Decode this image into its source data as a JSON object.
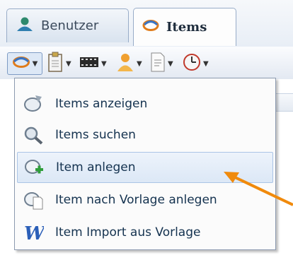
{
  "tabs": [
    {
      "label": "Benutzer",
      "icon": "user-icon",
      "active": false
    },
    {
      "label": "Items",
      "icon": "items-icon",
      "active": true
    }
  ],
  "toolbar": {
    "buttons": [
      {
        "icon": "items-icon",
        "active": true
      },
      {
        "icon": "clipboard-icon"
      },
      {
        "icon": "film-icon"
      },
      {
        "icon": "user-icon"
      },
      {
        "icon": "document-icon"
      },
      {
        "icon": "clock-icon"
      }
    ]
  },
  "menu": {
    "items": [
      {
        "label": "Items anzeigen",
        "icon": "items-view-icon"
      },
      {
        "label": "Items suchen",
        "icon": "search-icon"
      },
      {
        "label": "Item anlegen",
        "icon": "add-item-icon",
        "highlighted": true
      },
      {
        "label": "Item nach Vorlage anlegen",
        "icon": "template-icon"
      },
      {
        "label": "Item Import aus Vorlage",
        "icon": "word-icon"
      }
    ]
  },
  "annotation": {
    "color": "#f08a0c"
  }
}
